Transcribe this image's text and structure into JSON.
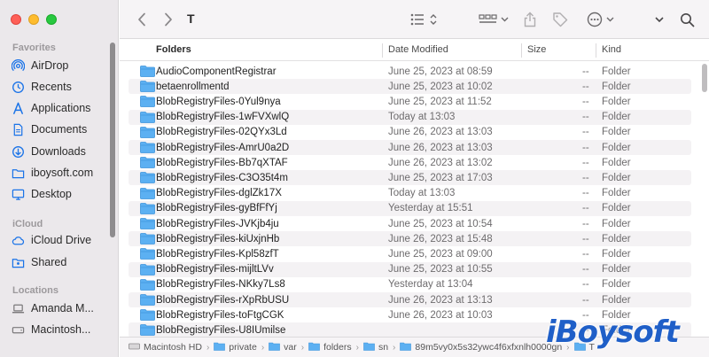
{
  "sidebar": {
    "sections": [
      {
        "label": "Favorites"
      },
      {
        "label": "iCloud"
      },
      {
        "label": "Locations"
      }
    ],
    "items": [
      {
        "label": "AirDrop",
        "icon": "airdrop-icon"
      },
      {
        "label": "Recents",
        "icon": "clock-icon"
      },
      {
        "label": "Applications",
        "icon": "applications-icon"
      },
      {
        "label": "Documents",
        "icon": "document-icon"
      },
      {
        "label": "Downloads",
        "icon": "download-icon"
      },
      {
        "label": "iboysoft.com",
        "icon": "folder-icon"
      },
      {
        "label": "Desktop",
        "icon": "desktop-icon"
      },
      {
        "label": "iCloud Drive",
        "icon": "cloud-icon"
      },
      {
        "label": "Shared",
        "icon": "shared-folder-icon"
      },
      {
        "label": "Amanda M...",
        "icon": "laptop-icon"
      },
      {
        "label": "Macintosh...",
        "icon": "disk-icon"
      }
    ]
  },
  "toolbar": {
    "title": "T"
  },
  "columns": {
    "name": "Folders",
    "date": "Date Modified",
    "size": "Size",
    "kind": "Kind"
  },
  "rows": [
    {
      "name": "AudioComponentRegistrar",
      "date": "June 25, 2023 at 08:59",
      "size": "--",
      "kind": "Folder"
    },
    {
      "name": "betaenrollmentd",
      "date": "June 25, 2023 at 10:02",
      "size": "--",
      "kind": "Folder"
    },
    {
      "name": "BlobRegistryFiles-0Yul9nya",
      "date": "June 25, 2023 at 11:52",
      "size": "--",
      "kind": "Folder"
    },
    {
      "name": "BlobRegistryFiles-1wFVXwlQ",
      "date": "Today at 13:03",
      "size": "--",
      "kind": "Folder"
    },
    {
      "name": "BlobRegistryFiles-02QYx3Ld",
      "date": "June 26, 2023 at 13:03",
      "size": "--",
      "kind": "Folder"
    },
    {
      "name": "BlobRegistryFiles-AmrU0a2D",
      "date": "June 26, 2023 at 13:03",
      "size": "--",
      "kind": "Folder"
    },
    {
      "name": "BlobRegistryFiles-Bb7qXTAF",
      "date": "June 26, 2023 at 13:02",
      "size": "--",
      "kind": "Folder"
    },
    {
      "name": "BlobRegistryFiles-C3O35t4m",
      "date": "June 25, 2023 at 17:03",
      "size": "--",
      "kind": "Folder"
    },
    {
      "name": "BlobRegistryFiles-dglZk17X",
      "date": "Today at 13:03",
      "size": "--",
      "kind": "Folder"
    },
    {
      "name": "BlobRegistryFiles-gyBfFfYj",
      "date": "Yesterday at 15:51",
      "size": "--",
      "kind": "Folder"
    },
    {
      "name": "BlobRegistryFiles-JVKjb4ju",
      "date": "June 25, 2023 at 10:54",
      "size": "--",
      "kind": "Folder"
    },
    {
      "name": "BlobRegistryFiles-kiUxjnHb",
      "date": "June 26, 2023 at 15:48",
      "size": "--",
      "kind": "Folder"
    },
    {
      "name": "BlobRegistryFiles-Kpl58zfT",
      "date": "June 25, 2023 at 09:00",
      "size": "--",
      "kind": "Folder"
    },
    {
      "name": "BlobRegistryFiles-mijltLVv",
      "date": "June 25, 2023 at 10:55",
      "size": "--",
      "kind": "Folder"
    },
    {
      "name": "BlobRegistryFiles-NKky7Ls8",
      "date": "Yesterday at 13:04",
      "size": "--",
      "kind": "Folder"
    },
    {
      "name": "BlobRegistryFiles-rXpRbUSU",
      "date": "June 26, 2023 at 13:13",
      "size": "--",
      "kind": "Folder"
    },
    {
      "name": "BlobRegistryFiles-toFtgCGK",
      "date": "June 26, 2023 at 10:03",
      "size": "--",
      "kind": "Folder"
    },
    {
      "name": "BlobRegistryFiles-U8IUmilse",
      "date": "",
      "size": "--",
      "kind": "Folder"
    }
  ],
  "pathbar": [
    {
      "label": "Macintosh HD",
      "icon": "disk-icon"
    },
    {
      "label": "private",
      "icon": "folder-icon"
    },
    {
      "label": "var",
      "icon": "folder-icon"
    },
    {
      "label": "folders",
      "icon": "folder-icon"
    },
    {
      "label": "sn",
      "icon": "folder-icon"
    },
    {
      "label": "89m5vy0x5s32ywc4f6xfxnlh0000gn",
      "icon": "folder-icon"
    },
    {
      "label": "T",
      "icon": "folder-icon"
    }
  ],
  "watermark": {
    "text": "iBoysoft"
  },
  "colors": {
    "accent": "#1a73e8",
    "folder": "#4aa3f0",
    "sidebar_bg": "#ebe8eb"
  }
}
